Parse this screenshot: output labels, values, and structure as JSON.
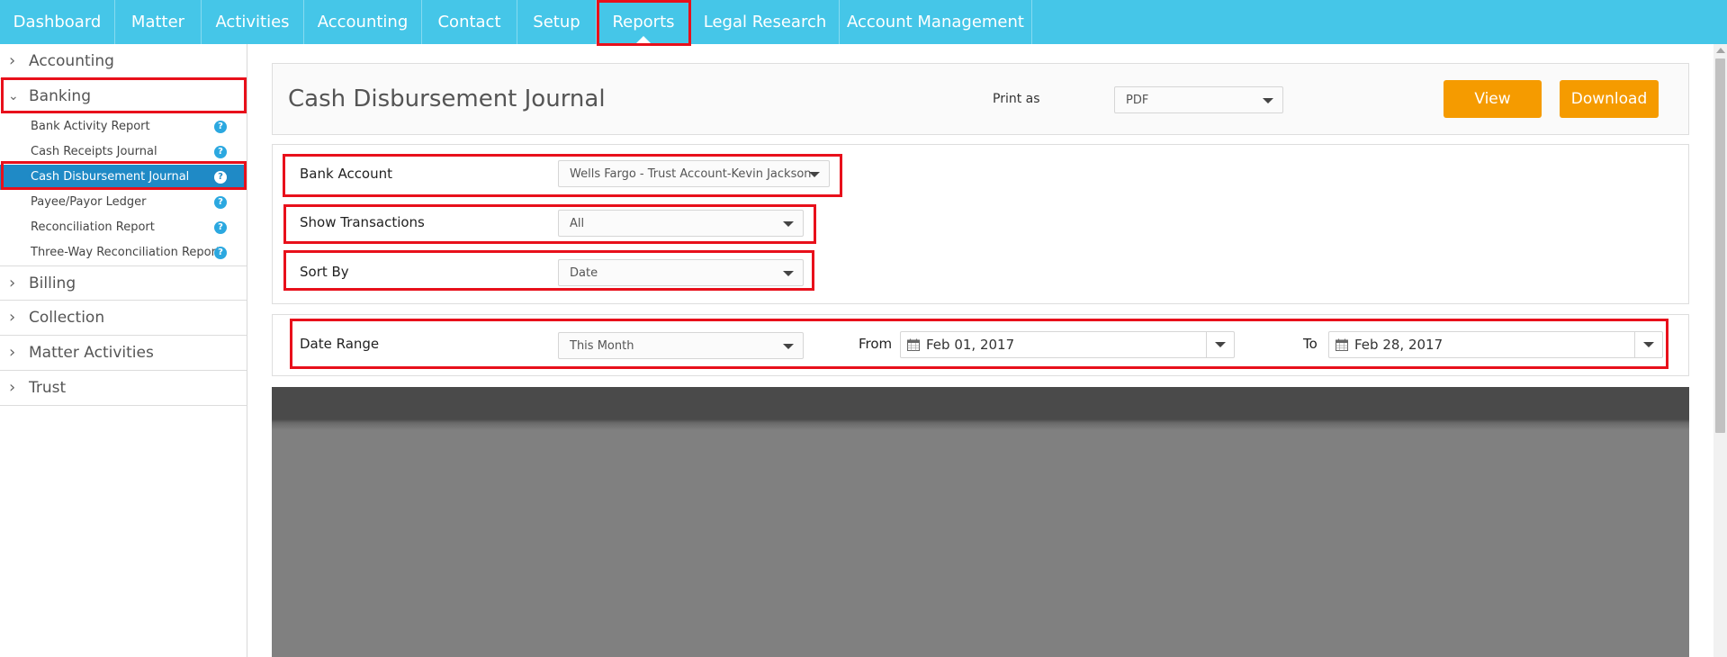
{
  "nav": {
    "items": [
      {
        "label": "Dashboard"
      },
      {
        "label": "Matter"
      },
      {
        "label": "Activities"
      },
      {
        "label": "Accounting"
      },
      {
        "label": "Contact"
      },
      {
        "label": "Setup"
      },
      {
        "label": "Reports"
      },
      {
        "label": "Legal Research"
      },
      {
        "label": "Account Management"
      }
    ],
    "active": "Reports"
  },
  "sidebar": {
    "groups": [
      {
        "label": "Accounting",
        "expanded": false
      },
      {
        "label": "Banking",
        "expanded": true
      },
      {
        "label": "Billing",
        "expanded": false
      },
      {
        "label": "Collection",
        "expanded": false
      },
      {
        "label": "Matter Activities",
        "expanded": false
      },
      {
        "label": "Trust",
        "expanded": false
      }
    ],
    "banking_items": [
      {
        "label": "Bank Activity Report"
      },
      {
        "label": "Cash Receipts Journal"
      },
      {
        "label": "Cash Disbursement Journal",
        "active": true
      },
      {
        "label": "Payee/Payor Ledger"
      },
      {
        "label": "Reconciliation Report"
      },
      {
        "label": "Three-Way Reconciliation Report"
      }
    ],
    "help_glyph": "?"
  },
  "header": {
    "title": "Cash Disbursement Journal",
    "print_as_label": "Print as",
    "print_as_value": "PDF",
    "view_label": "View",
    "download_label": "Download"
  },
  "form": {
    "bank_account": {
      "label": "Bank Account",
      "value": "Wells Fargo - Trust Account-Kevin Jackson"
    },
    "show_transactions": {
      "label": "Show Transactions",
      "value": "All"
    },
    "sort_by": {
      "label": "Sort By",
      "value": "Date"
    }
  },
  "date_range": {
    "label": "Date Range",
    "value": "This Month",
    "from_label": "From",
    "from_value": "Feb 01, 2017",
    "to_label": "To",
    "to_value": "Feb 28, 2017"
  },
  "colors": {
    "nav_bg": "#45c6e8",
    "active_item": "#1f8ac6",
    "button": "#f59b00",
    "highlight": "#e8101b"
  }
}
